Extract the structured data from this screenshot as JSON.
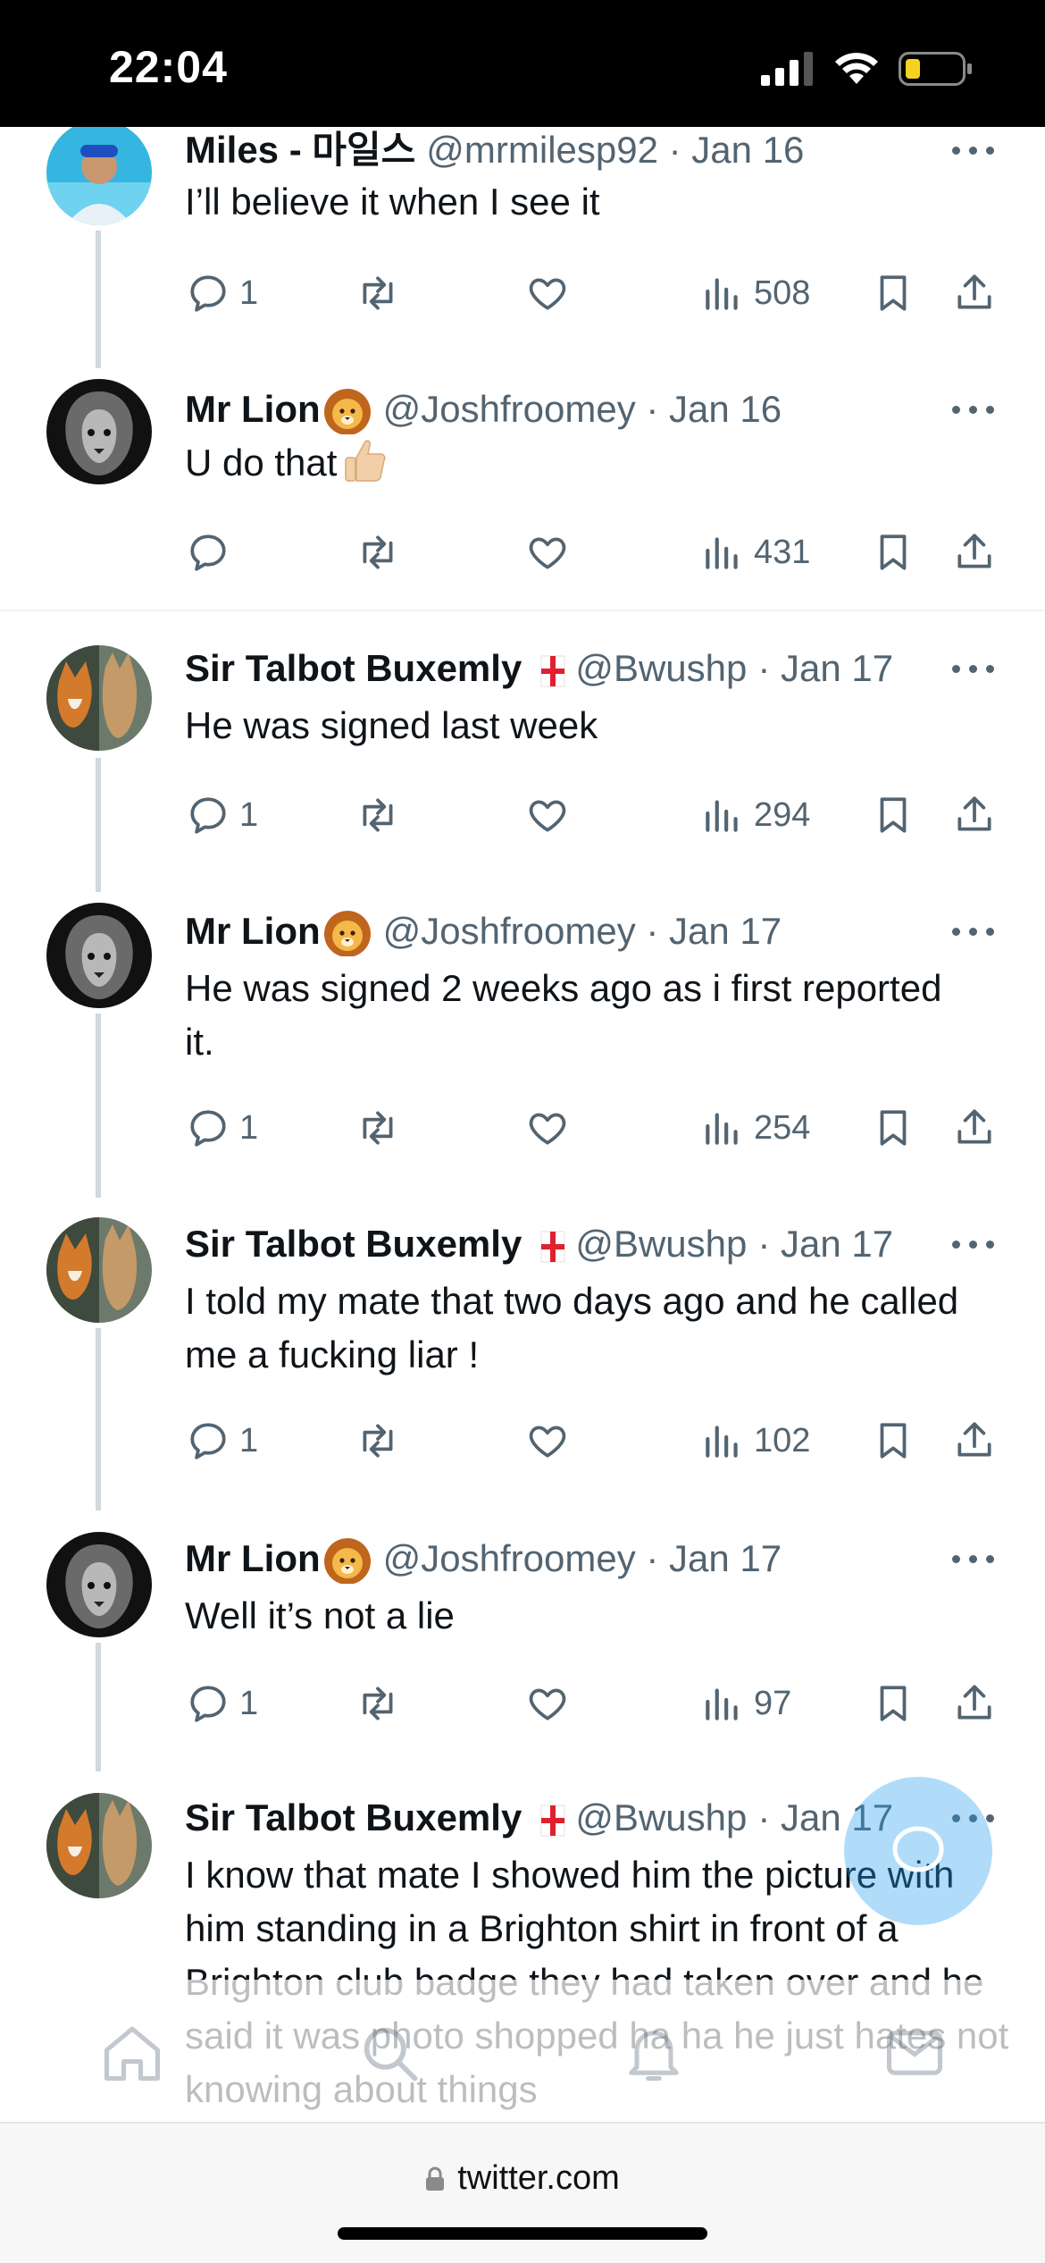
{
  "status_bar": {
    "time": "22:04"
  },
  "tweets": [
    {
      "name": "Miles - 마일스",
      "handle": "@mrmilesp92 · Jan 16",
      "text": "I’ll believe it when I see it",
      "replies": "1",
      "views": "508",
      "avatar": "blue"
    },
    {
      "name": "Mr Lion",
      "handle": "@Joshfroomey · Jan 16",
      "text": "U do that",
      "replies": "",
      "views": "431",
      "avatar": "lion"
    },
    {
      "name": "Sir Talbot Buxemly",
      "handle": "@Bwushp",
      "date": "· Jan 17",
      "text": "He was signed last week",
      "replies": "1",
      "views": "294",
      "avatar": "pets"
    },
    {
      "name": "Mr Lion",
      "handle": "@Joshfroomey · Jan 17",
      "text": "He was signed 2 weeks ago as i first reported it.",
      "replies": "1",
      "views": "254",
      "avatar": "lion"
    },
    {
      "name": "Sir Talbot Buxemly",
      "handle": "@Bwushp",
      "date": "· Jan 17",
      "text": "I told my mate that two days ago and he called me a fucking liar !",
      "replies": "1",
      "views": "102",
      "avatar": "pets"
    },
    {
      "name": "Mr Lion",
      "handle": "@Joshfroomey · Jan 17",
      "text": "Well it’s not a lie",
      "replies": "1",
      "views": "97",
      "avatar": "lion"
    },
    {
      "name": "Sir Talbot Buxemly",
      "handle": "@Bwushp",
      "date": "· Jan 17",
      "text": "I know that mate I showed him the picture with him standing in a Brighton shirt in front of a Brighton club badge they had taken over and he said it was photo shopped ha ha he just hates not knowing about things",
      "avatar": "pets"
    }
  ],
  "browser": {
    "url": "twitter.com"
  },
  "colors": {
    "accent": "#1d9bf0",
    "muted": "#536471",
    "thread_line": "#cfd9de"
  }
}
